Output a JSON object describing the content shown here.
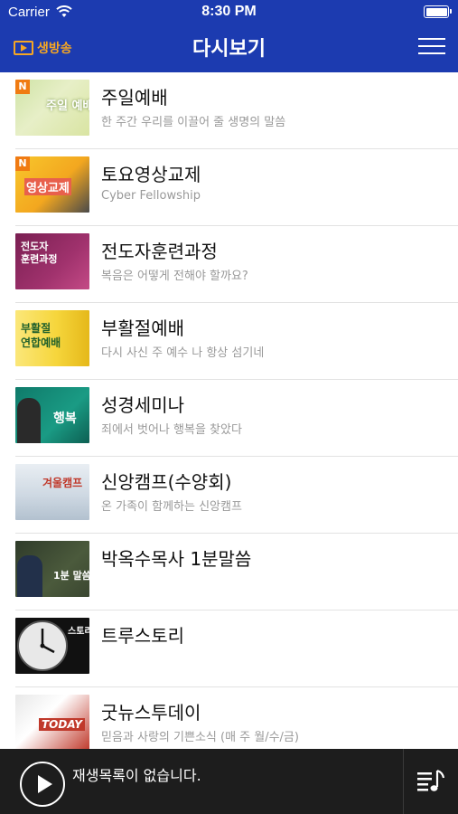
{
  "status": {
    "carrier": "Carrier",
    "time": "8:30 PM"
  },
  "nav": {
    "live_label": "생방송",
    "title": "다시보기"
  },
  "items": [
    {
      "title": "주일예배",
      "subtitle": "한 주간 우리를 이끌어 줄 생명의 말씀",
      "thumb_caption": "주일\n예배",
      "badge": "N"
    },
    {
      "title": "토요영상교제",
      "subtitle": "Cyber Fellowship",
      "thumb_caption": "영상교제",
      "badge": "N"
    },
    {
      "title": "전도자훈련과정",
      "subtitle": "복음은 어떻게 전해야 할까요?",
      "thumb_caption": "전도자\n훈련과정",
      "badge": ""
    },
    {
      "title": "부활절예배",
      "subtitle": "다시 사신 주 예수 나 항상 섬기네",
      "thumb_caption": "부활절\n연합예배",
      "badge": ""
    },
    {
      "title": "성경세미나",
      "subtitle": "죄에서 벗어나 행복을 찾았다",
      "thumb_caption": "행복",
      "badge": ""
    },
    {
      "title": "신앙캠프(수양회)",
      "subtitle": "온 가족이 함께하는 신앙캠프",
      "thumb_caption": "겨울캠프",
      "badge": ""
    },
    {
      "title": "박옥수목사 1분말씀",
      "subtitle": "",
      "thumb_caption": "1분 말씀",
      "badge": ""
    },
    {
      "title": "트루스토리",
      "subtitle": "",
      "thumb_caption": "스토리",
      "badge": ""
    },
    {
      "title": "굿뉴스투데이",
      "subtitle": "믿음과 사랑의 기쁜소식 (매 주 월/수/금)",
      "thumb_caption": "TODAY",
      "badge": ""
    }
  ],
  "player": {
    "status_text": "재생목록이 없습니다."
  },
  "colors": {
    "header": "#1c3bb0",
    "accent": "#f5a623",
    "player_bg": "#1d1d1d"
  }
}
